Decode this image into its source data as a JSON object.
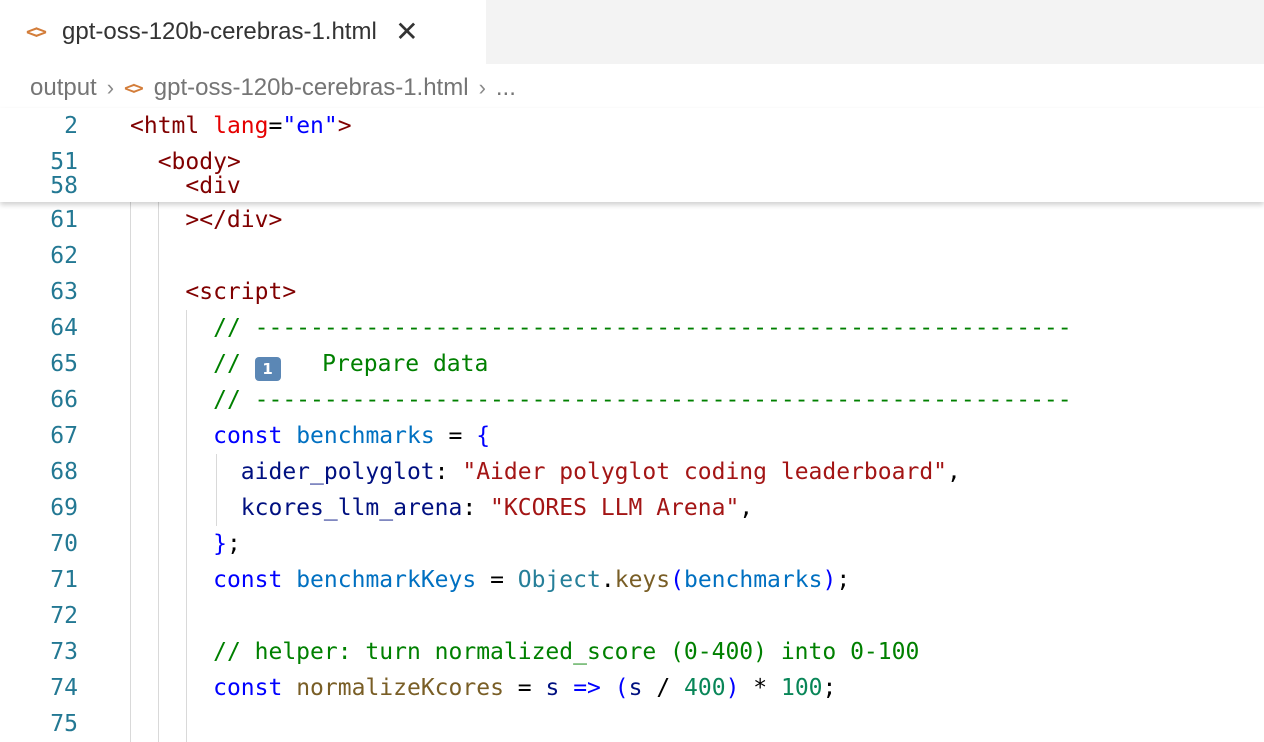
{
  "tab": {
    "icon": "code-file-icon",
    "title": "gpt-oss-120b-cerebras-1.html",
    "close": "✕"
  },
  "breadcrumb": {
    "folder": "output",
    "separator": "›",
    "file": "gpt-oss-120b-cerebras-1.html",
    "more": "..."
  },
  "sticky_lines": [
    {
      "num": "2",
      "tokens": [
        [
          "t-plain",
          ""
        ],
        [
          "t-tag",
          "<html"
        ],
        [
          "t-plain",
          " "
        ],
        [
          "t-attr",
          "lang"
        ],
        [
          "t-plain",
          "="
        ],
        [
          "t-str",
          "\"en\""
        ],
        [
          "t-tag",
          ">"
        ]
      ]
    },
    {
      "num": "51",
      "tokens": [
        [
          "t-plain",
          "  "
        ],
        [
          "t-tag",
          "<body>"
        ]
      ]
    },
    {
      "num": "58",
      "tokens": [
        [
          "t-plain",
          "    "
        ],
        [
          "t-tag",
          "<div"
        ]
      ]
    }
  ],
  "lines": [
    {
      "num": "61",
      "tokens": [
        [
          "t-plain",
          "    "
        ],
        [
          "t-tag",
          "></div>"
        ]
      ]
    },
    {
      "num": "62",
      "tokens": []
    },
    {
      "num": "63",
      "tokens": [
        [
          "t-plain",
          "    "
        ],
        [
          "t-tag",
          "<script>"
        ]
      ]
    },
    {
      "num": "64",
      "tokens": [
        [
          "t-plain",
          "      "
        ],
        [
          "t-cmt",
          "// -----------------------------------------------------------"
        ]
      ]
    },
    {
      "num": "65",
      "tokens": [
        [
          "t-plain",
          "      "
        ],
        [
          "t-cmt",
          "// "
        ],
        [
          "emoji",
          "1"
        ],
        [
          "t-cmt",
          "   Prepare data"
        ]
      ]
    },
    {
      "num": "66",
      "tokens": [
        [
          "t-plain",
          "      "
        ],
        [
          "t-cmt",
          "// -----------------------------------------------------------"
        ]
      ]
    },
    {
      "num": "67",
      "tokens": [
        [
          "t-plain",
          "      "
        ],
        [
          "t-kw",
          "const"
        ],
        [
          "t-plain",
          " "
        ],
        [
          "t-var",
          "benchmarks"
        ],
        [
          "t-plain",
          " = "
        ],
        [
          "t-kw",
          "{"
        ]
      ]
    },
    {
      "num": "68",
      "tokens": [
        [
          "t-plain",
          "        "
        ],
        [
          "t-prop",
          "aider_polyglot"
        ],
        [
          "t-plain",
          ": "
        ],
        [
          "t-jsstr",
          "\"Aider polyglot coding leaderboard\""
        ],
        [
          "t-plain",
          ","
        ]
      ]
    },
    {
      "num": "69",
      "tokens": [
        [
          "t-plain",
          "        "
        ],
        [
          "t-prop",
          "kcores_llm_arena"
        ],
        [
          "t-plain",
          ": "
        ],
        [
          "t-jsstr",
          "\"KCORES LLM Arena\""
        ],
        [
          "t-plain",
          ","
        ]
      ]
    },
    {
      "num": "70",
      "tokens": [
        [
          "t-plain",
          "      "
        ],
        [
          "t-kw",
          "}"
        ],
        [
          "t-plain",
          ";"
        ]
      ]
    },
    {
      "num": "71",
      "tokens": [
        [
          "t-plain",
          "      "
        ],
        [
          "t-kw",
          "const"
        ],
        [
          "t-plain",
          " "
        ],
        [
          "t-var",
          "benchmarkKeys"
        ],
        [
          "t-plain",
          " = "
        ],
        [
          "t-cls",
          "Object"
        ],
        [
          "t-plain",
          "."
        ],
        [
          "t-fn",
          "keys"
        ],
        [
          "t-kw",
          "("
        ],
        [
          "t-var",
          "benchmarks"
        ],
        [
          "t-kw",
          ")"
        ],
        [
          "t-plain",
          ";"
        ]
      ]
    },
    {
      "num": "72",
      "tokens": []
    },
    {
      "num": "73",
      "tokens": [
        [
          "t-plain",
          "      "
        ],
        [
          "t-cmt",
          "// helper: turn normalized_score (0-400) into 0-100"
        ]
      ]
    },
    {
      "num": "74",
      "tokens": [
        [
          "t-plain",
          "      "
        ],
        [
          "t-kw",
          "const"
        ],
        [
          "t-plain",
          " "
        ],
        [
          "t-fn",
          "normalizeKcores"
        ],
        [
          "t-plain",
          " = "
        ],
        [
          "t-prop",
          "s"
        ],
        [
          "t-plain",
          " "
        ],
        [
          "t-kw",
          "=>"
        ],
        [
          "t-plain",
          " "
        ],
        [
          "t-kw",
          "("
        ],
        [
          "t-prop",
          "s"
        ],
        [
          "t-plain",
          " / "
        ],
        [
          "t-num",
          "400"
        ],
        [
          "t-kw",
          ")"
        ],
        [
          "t-plain",
          " * "
        ],
        [
          "t-num",
          "100"
        ],
        [
          "t-plain",
          ";"
        ]
      ]
    },
    {
      "num": "75",
      "tokens": []
    }
  ],
  "colors": {
    "line_number": "#237893",
    "tag": "#800000",
    "comment": "#008000",
    "keyword": "#0000ff"
  }
}
